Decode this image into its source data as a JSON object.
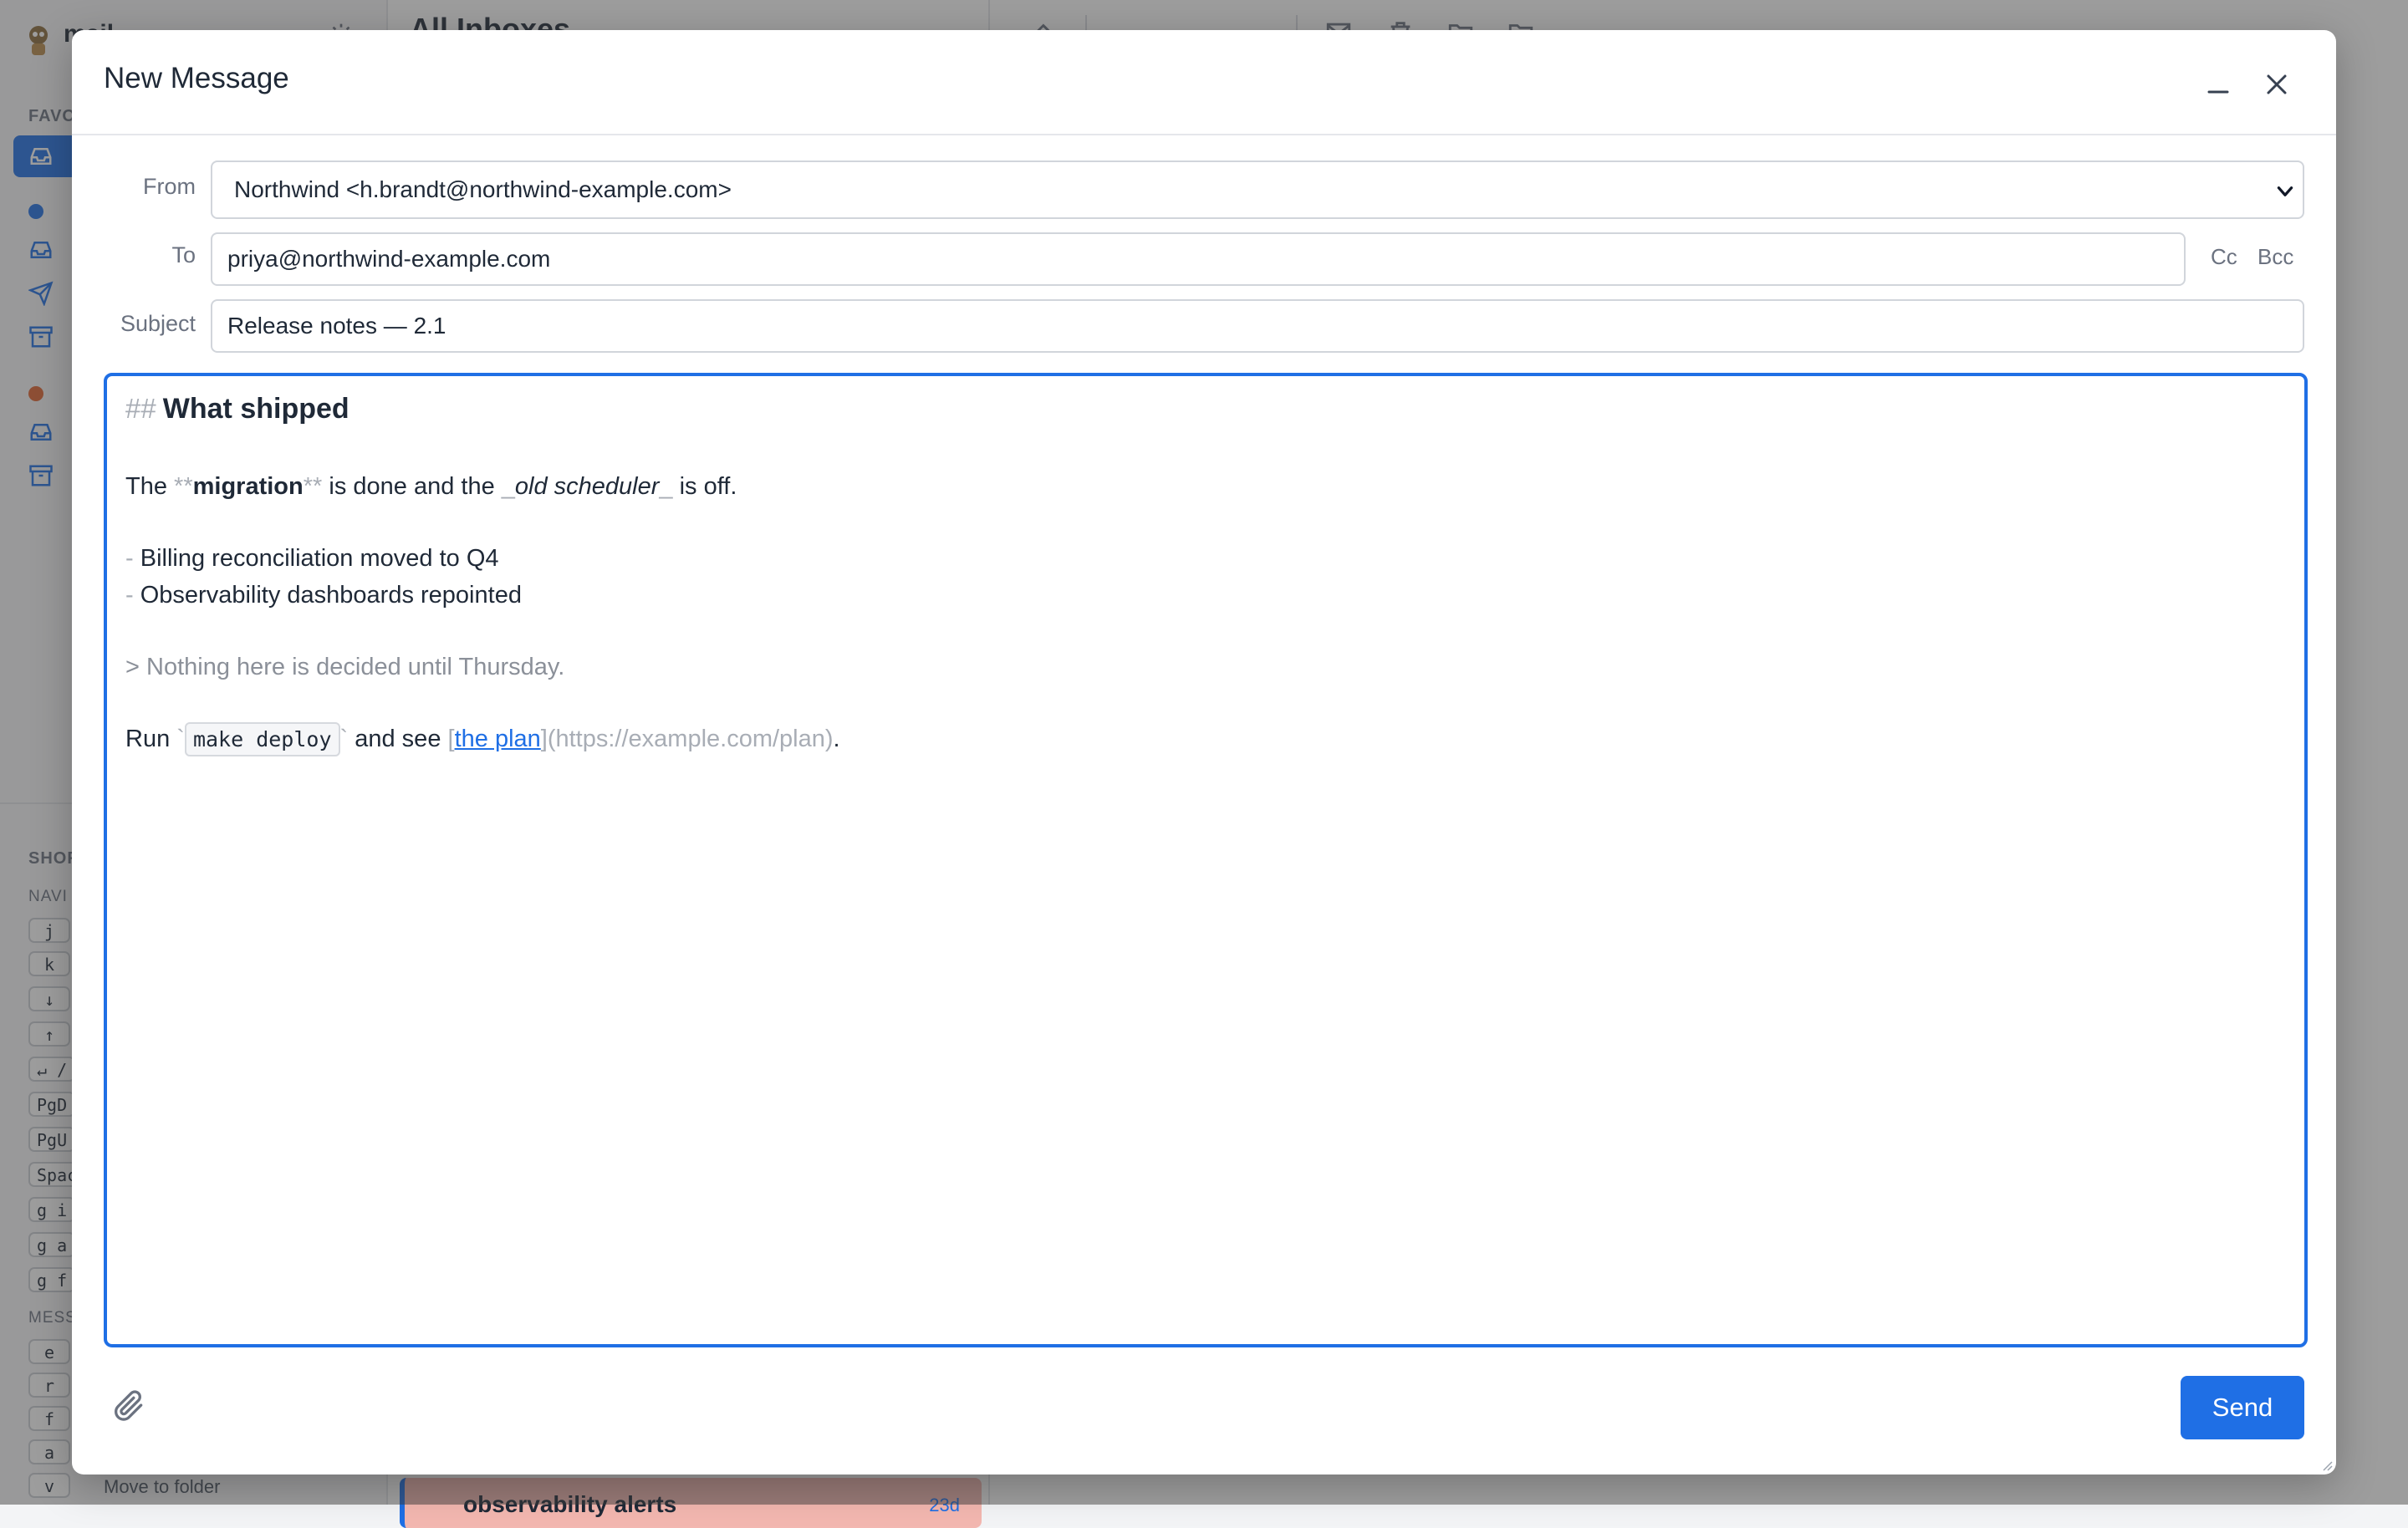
{
  "background": {
    "app_title": "mail",
    "favorites_label": "FAVO",
    "list_title": "All Inboxes",
    "shortcuts_label": "SHOR",
    "navigation_label": "NAVI",
    "messages_label": "MESS",
    "nav_keys": [
      "j",
      "k",
      "↓",
      "↑",
      "↵ /",
      "PgD",
      "PgU",
      "Spac",
      "g i",
      "g a",
      "g f"
    ],
    "message_keys": [
      "e",
      "r",
      "f",
      "a",
      "v"
    ],
    "move_to_folder": "Move to folder",
    "list_card_title": "observability alerts",
    "list_card_age": "23d",
    "colors": {
      "accent": "#1f6fe5",
      "account1_dot": "#1f6fe5",
      "account2_dot": "#e0622f"
    }
  },
  "compose": {
    "title": "New Message",
    "from_label": "From",
    "from_value": "Northwind <h.brandt@northwind-example.com>",
    "to_label": "To",
    "to_value": "priya@northwind-example.com",
    "cc_label": "Cc",
    "bcc_label": "Bcc",
    "subject_label": "Subject",
    "subject_value": "Release notes — 2.1",
    "send_label": "Send",
    "body": {
      "heading_marker": "##",
      "heading_text": "What shipped",
      "p1_a": "The ",
      "p1_bold_marker": "**",
      "p1_bold": "migration",
      "p1_b": " is done and the ",
      "p1_italic_marker": "_",
      "p1_italic": "old scheduler",
      "p1_c": " is off.",
      "list_marker": "-",
      "list_items": [
        "Billing reconciliation moved to Q4",
        "Observability dashboards repointed"
      ],
      "quote_marker": ">",
      "quote_text": "Nothing here is decided until Thursday.",
      "p2_a": "Run ",
      "code_marker": "`",
      "code_text": "make deploy",
      "p2_b": " and see ",
      "link_open": "[",
      "link_text": "the plan",
      "link_close": "]",
      "link_url": "(https://example.com/plan)",
      "p2_c": "."
    }
  }
}
